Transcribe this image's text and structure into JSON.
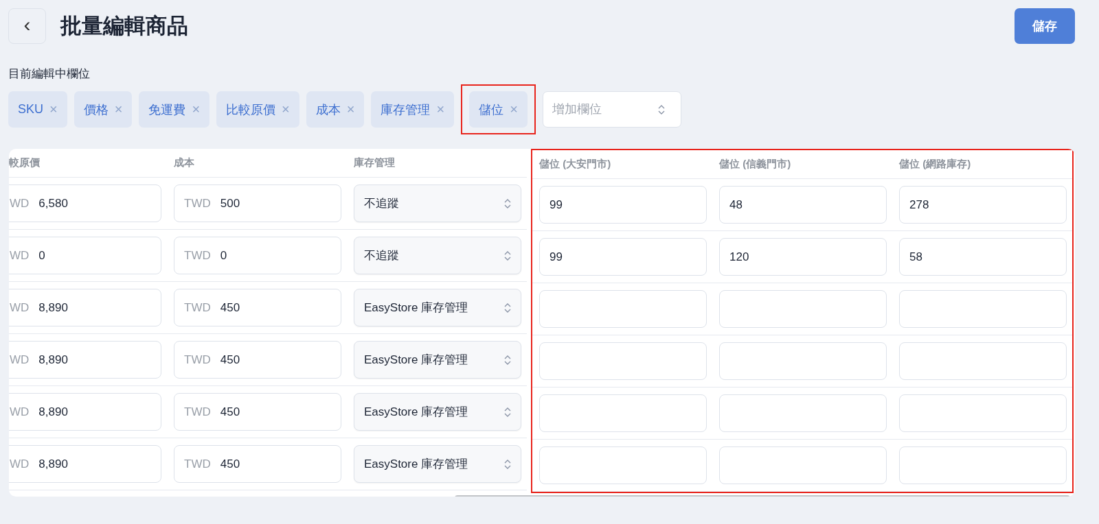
{
  "header": {
    "back": "‹",
    "title": "批量編輯商品",
    "save": "儲存"
  },
  "fields": {
    "label": "目前編輯中欄位",
    "remove": "×",
    "add_placeholder": "增加欄位",
    "tags": [
      {
        "label": "SKU",
        "highlighted": false
      },
      {
        "label": "價格",
        "highlighted": false
      },
      {
        "label": "免運費",
        "highlighted": false
      },
      {
        "label": "比較原價",
        "highlighted": false
      },
      {
        "label": "成本",
        "highlighted": false
      },
      {
        "label": "庫存管理",
        "highlighted": false
      },
      {
        "label": "儲位",
        "highlighted": true
      }
    ]
  },
  "table": {
    "columns": [
      {
        "header": "較原價",
        "kind": "money",
        "highlighted": false
      },
      {
        "header": "成本",
        "kind": "money",
        "highlighted": false
      },
      {
        "header": "庫存管理",
        "kind": "select",
        "highlighted": false
      },
      {
        "header": "儲位 (大安門市)",
        "kind": "text",
        "highlighted": true
      },
      {
        "header": "儲位 (信義門市)",
        "kind": "text",
        "highlighted": true
      },
      {
        "header": "儲位 (網路庫存)",
        "kind": "text",
        "highlighted": true
      }
    ],
    "rows": [
      [
        {
          "prefix": "WD",
          "value": "6,580"
        },
        {
          "prefix": "TWD",
          "value": "500"
        },
        {
          "value": "不追蹤"
        },
        {
          "value": "99"
        },
        {
          "value": "48"
        },
        {
          "value": "278"
        }
      ],
      [
        {
          "prefix": "WD",
          "value": "0"
        },
        {
          "prefix": "TWD",
          "value": "0"
        },
        {
          "value": "不追蹤"
        },
        {
          "value": "99"
        },
        {
          "value": "120"
        },
        {
          "value": "58"
        }
      ],
      [
        {
          "prefix": "WD",
          "value": "8,890"
        },
        {
          "prefix": "TWD",
          "value": "450"
        },
        {
          "value": "EasyStore 庫存管理"
        },
        {},
        {},
        {}
      ],
      [
        {
          "prefix": "WD",
          "value": "8,890"
        },
        {
          "prefix": "TWD",
          "value": "450"
        },
        {
          "value": "EasyStore 庫存管理"
        },
        {},
        {},
        {}
      ],
      [
        {
          "prefix": "WD",
          "value": "8,890"
        },
        {
          "prefix": "TWD",
          "value": "450"
        },
        {
          "value": "EasyStore 庫存管理"
        },
        {},
        {},
        {}
      ],
      [
        {
          "prefix": "WD",
          "value": "8,890"
        },
        {
          "prefix": "TWD",
          "value": "450"
        },
        {
          "value": "EasyStore 庫存管理"
        },
        {},
        {},
        {}
      ]
    ]
  }
}
